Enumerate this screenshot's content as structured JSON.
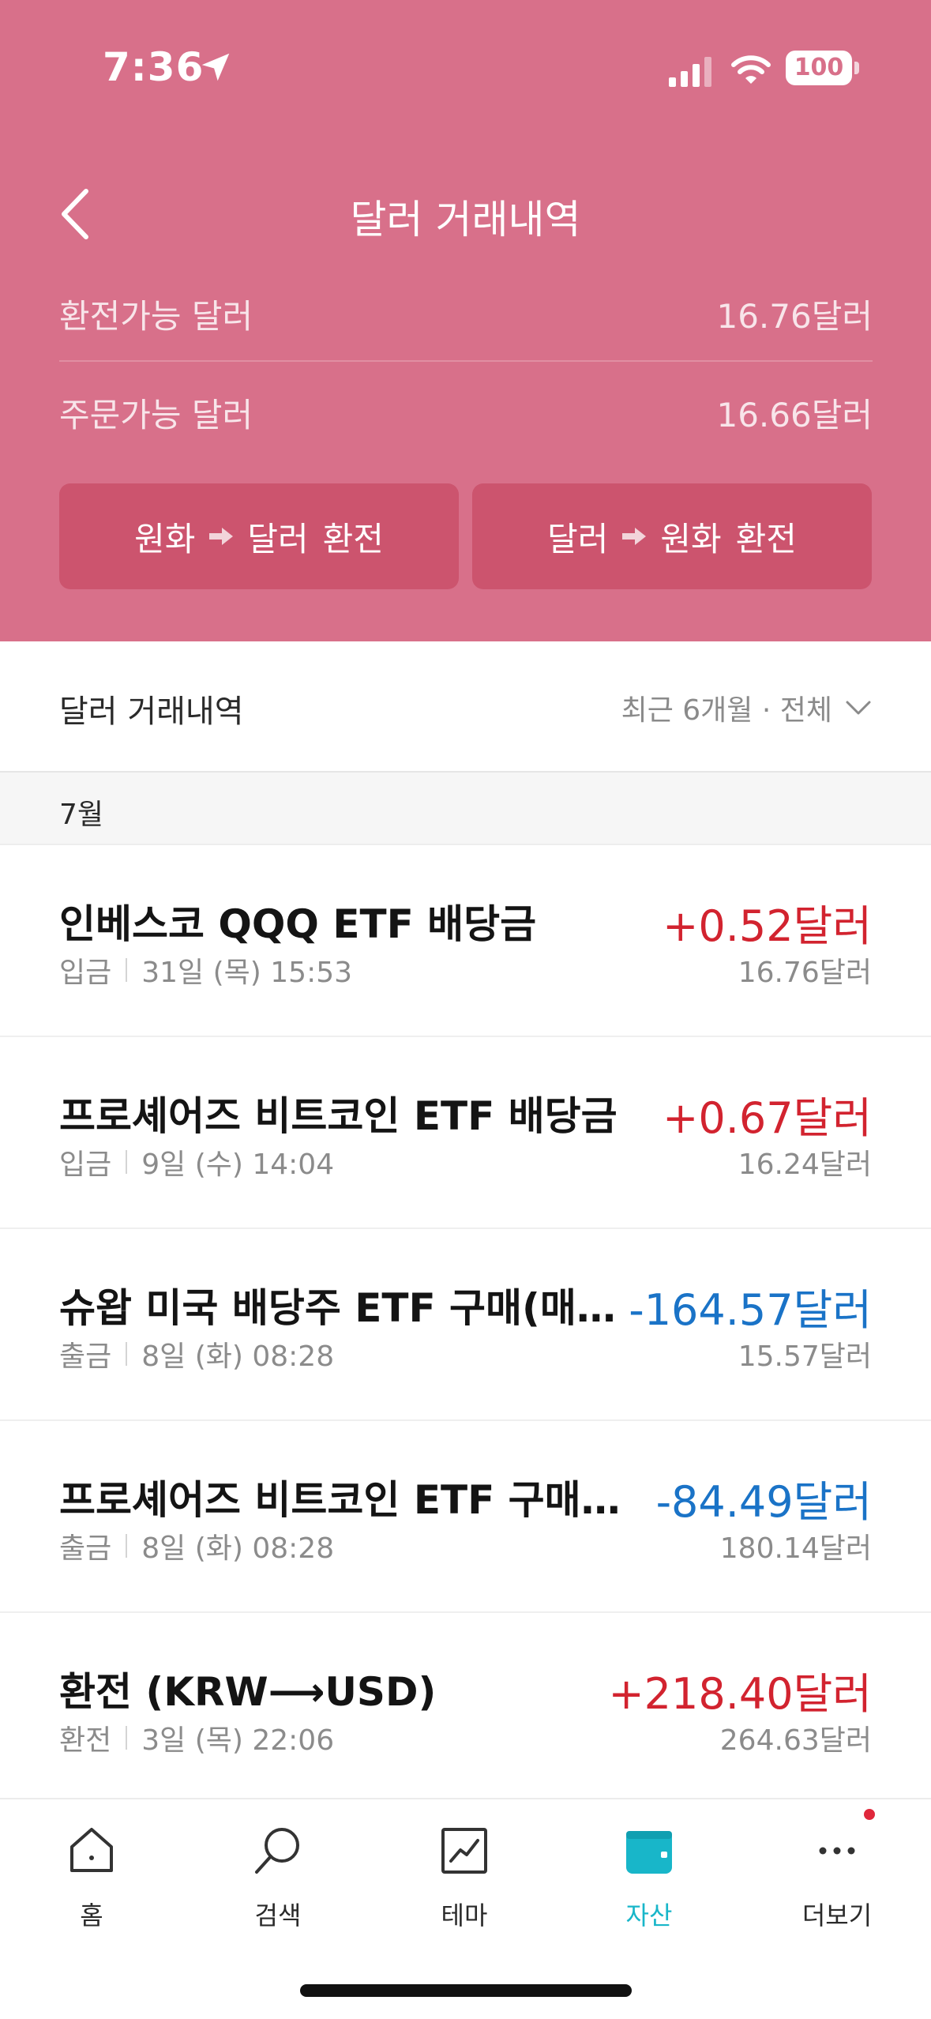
{
  "status": {
    "time": "7:36",
    "battery": "100"
  },
  "header": {
    "title": "달러 거래내역"
  },
  "balances": [
    {
      "label": "환전가능 달러",
      "value": "16.76달러"
    },
    {
      "label": "주문가능 달러",
      "value": "16.66달러"
    }
  ],
  "exchange_buttons": {
    "krw_to_usd": {
      "from": "원화",
      "to": "달러",
      "action": "환전"
    },
    "usd_to_krw": {
      "from": "달러",
      "to": "원화",
      "action": "환전"
    }
  },
  "section": {
    "title": "달러 거래내역",
    "filter": "최근 6개월 · 전체"
  },
  "month": "7월",
  "transactions": [
    {
      "name": "인베스코 QQQ ETF 배당금",
      "type": "입금",
      "date": "31일 (목) 15:53",
      "amount": "+0.52달러",
      "balance": "16.76달러",
      "direction": "plus"
    },
    {
      "name": "프로셰어즈 비트코인 ETF 배당금",
      "type": "입금",
      "date": "9일 (수) 14:04",
      "amount": "+0.67달러",
      "balance": "16.24달러",
      "direction": "plus"
    },
    {
      "name": "슈왑 미국 배당주 ETF 구매(매수)",
      "type": "출금",
      "date": "8일 (화) 08:28",
      "amount": "-164.57달러",
      "balance": "15.57달러",
      "direction": "minus"
    },
    {
      "name": "프로셰어즈 비트코인 ETF 구매(매...",
      "type": "출금",
      "date": "8일 (화) 08:28",
      "amount": "-84.49달러",
      "balance": "180.14달러",
      "direction": "minus"
    },
    {
      "name": "환전 (KRW⟶USD)",
      "type": "환전",
      "date": "3일 (목) 22:06",
      "amount": "+218.40달러",
      "balance": "264.63달러",
      "direction": "plus"
    }
  ],
  "tabs": [
    {
      "label": "홈",
      "icon": "home-icon"
    },
    {
      "label": "검색",
      "icon": "search-icon"
    },
    {
      "label": "테마",
      "icon": "chart-icon"
    },
    {
      "label": "자산",
      "icon": "wallet-icon",
      "active": true
    },
    {
      "label": "더보기",
      "icon": "more-icon"
    }
  ],
  "colors": {
    "header_bg": "#d8708a",
    "button_bg": "#cc546e",
    "plus": "#d2232f",
    "minus": "#1a73c7",
    "active_tab": "#18b6c9"
  }
}
